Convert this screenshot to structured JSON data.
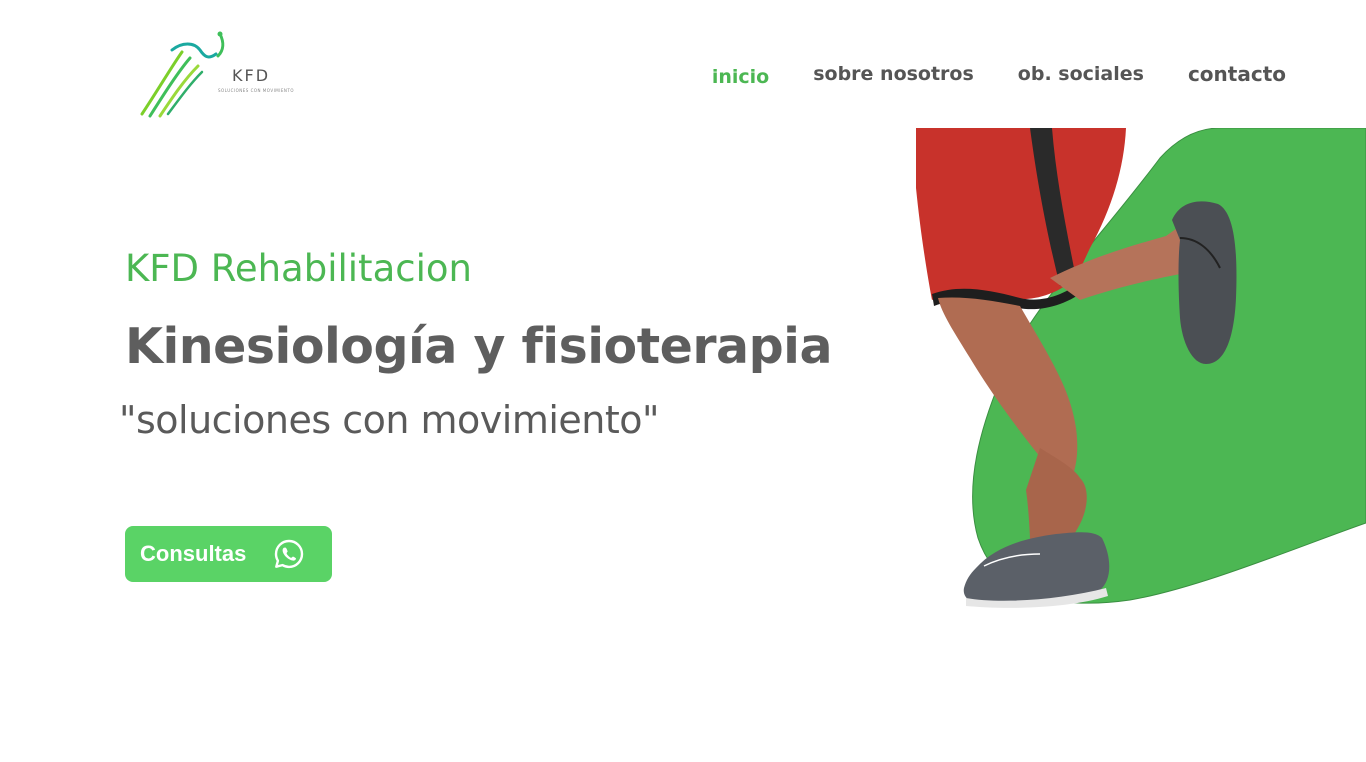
{
  "brand": {
    "logo_text": "KFD",
    "logo_tagline": "SOLUCIONES CON MOVIMIENTO"
  },
  "nav": {
    "items": [
      {
        "label": "inicio",
        "active": true
      },
      {
        "label": "sobre nosotros",
        "active": false
      },
      {
        "label": "ob. sociales",
        "active": false
      },
      {
        "label": "contacto",
        "active": false
      }
    ]
  },
  "hero": {
    "subtitle": "KFD Rehabilitacion",
    "title": "Kinesiología y fisioterapia",
    "slogan": "\"soluciones con movimiento\"",
    "cta_label": "Consultas"
  },
  "colors": {
    "accent": "#4cb753",
    "button": "#5ad366",
    "text": "#5e5e5e"
  },
  "icons": {
    "cta_icon": "whatsapp-icon",
    "hero_image": "runner-legs-image"
  }
}
